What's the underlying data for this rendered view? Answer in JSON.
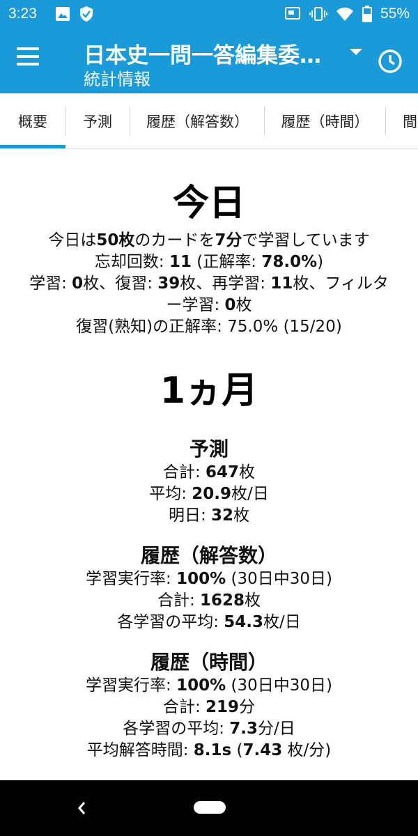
{
  "status_bar": {
    "time": "3:23",
    "battery": "55%"
  },
  "app_bar": {
    "title": "日本史一問一答編集委…",
    "subtitle": "統計情報"
  },
  "tabs": [
    {
      "label": "概要",
      "selected": true
    },
    {
      "label": "予測",
      "selected": false
    },
    {
      "label": "履歴（解答数）",
      "selected": false
    },
    {
      "label": "履歴（時間）",
      "selected": false
    },
    {
      "label": "間",
      "selected": false
    }
  ],
  "today": {
    "heading": "今日",
    "l1": {
      "a": "今日は",
      "b": "50枚",
      "c": "のカードを",
      "d": "7分",
      "e": "で学習しています"
    },
    "l2": {
      "a": "忘却回数: ",
      "b": "11",
      "c": " (正解率: ",
      "d": "78.0%",
      "e": ")"
    },
    "l3": {
      "a": "学習: ",
      "b": "0",
      "c": "枚、復習: ",
      "d": "39",
      "e": "枚、再学習: ",
      "f": "11",
      "g": "枚、フィルタ"
    },
    "l4": {
      "a": "ー学習: ",
      "b": "0",
      "c": "枚"
    },
    "l5": "復習(熟知)の正解率: 75.0% (15/20)"
  },
  "month": {
    "heading": "1ヵ月",
    "forecast": {
      "title": "予測",
      "total": {
        "a": "合計: ",
        "b": "647",
        "c": "枚"
      },
      "average": {
        "a": "平均: ",
        "b": "20.9",
        "c": "枚/日"
      },
      "tomorrow": {
        "a": "明日: ",
        "b": "32",
        "c": "枚"
      }
    },
    "history_count": {
      "title": "履歴（解答数）",
      "rate": {
        "a": "学習実行率: ",
        "b": "100%",
        "c": " (30日中30日)"
      },
      "total": {
        "a": "合計: ",
        "b": "1628",
        "c": "枚"
      },
      "average": {
        "a": "各学習の平均: ",
        "b": "54.3",
        "c": "枚/日"
      }
    },
    "history_time": {
      "title": "履歴（時間）",
      "rate": {
        "a": "学習実行率: ",
        "b": "100%",
        "c": " (30日中30日)"
      },
      "total": {
        "a": "合計: ",
        "b": "219",
        "c": "分"
      },
      "average": {
        "a": "各学習の平均: ",
        "b": "7.3",
        "c": "分/日"
      },
      "answer_time": {
        "a": "平均解答時間: ",
        "b": "8.1s",
        "c": " (",
        "d": "7.43",
        "e": " 枚/分)"
      }
    }
  },
  "icons": {
    "image": "image-icon",
    "shield": "shield-icon",
    "cast": "cast-icon",
    "vibrate": "vibrate-icon",
    "wifi": "wifi-icon",
    "battery": "battery-icon",
    "menu": "menu-icon",
    "clock": "clock-icon",
    "back": "back-icon",
    "home": "home-pill-icon"
  },
  "colors": {
    "primary": "#1a9ad9",
    "nav_bar": "#000000",
    "text": "#111111"
  }
}
